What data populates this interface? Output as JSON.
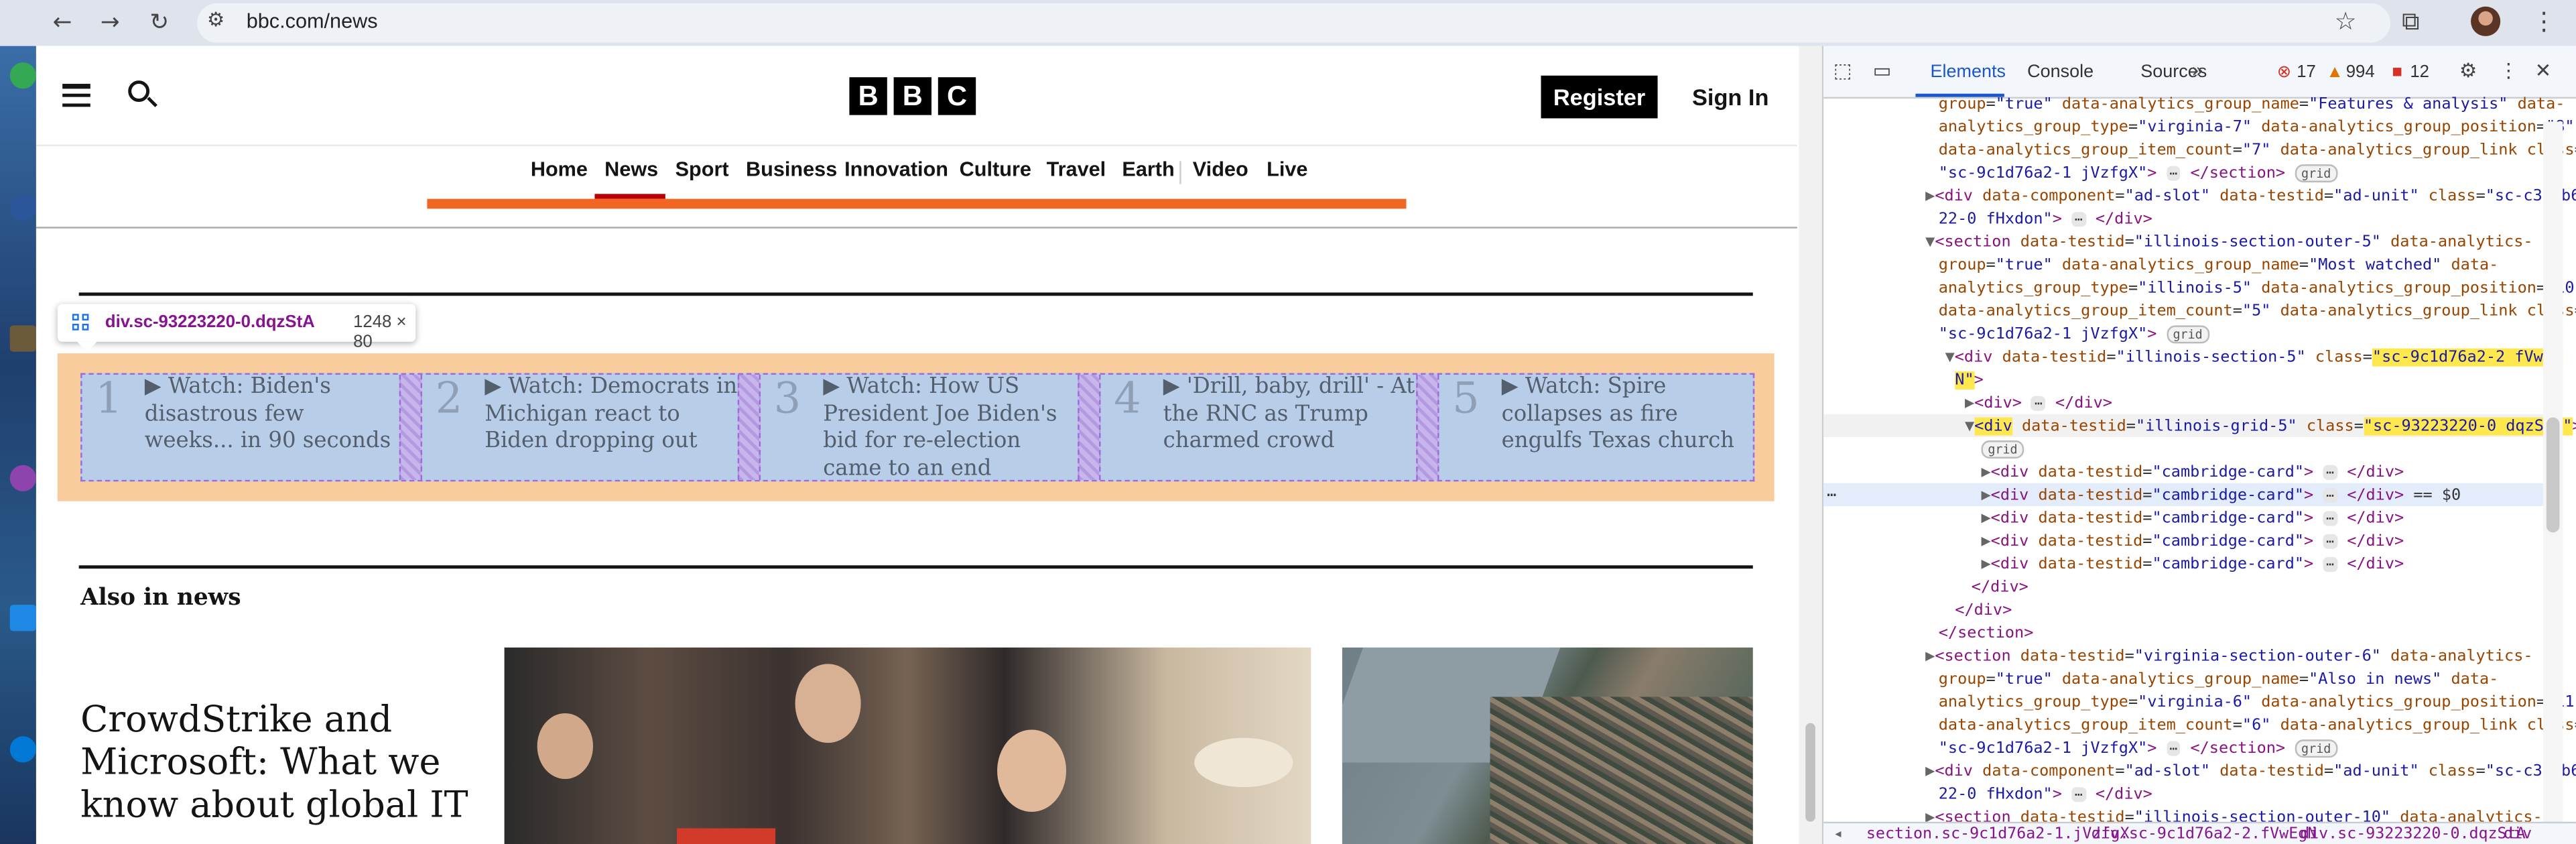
{
  "browser": {
    "url": "bbc.com/news"
  },
  "header": {
    "logo_letters": [
      "B",
      "B",
      "C"
    ],
    "register_label": "Register",
    "signin_label": "Sign In"
  },
  "nav": {
    "items": [
      "Home",
      "News",
      "Sport",
      "Business",
      "Innovation",
      "Culture",
      "Travel",
      "Earth",
      "Video",
      "Live"
    ],
    "active": "News"
  },
  "inspector_tooltip": {
    "selector": "div.sc-93223220-0.dqzStA",
    "size": "1248 × 80"
  },
  "most_watched": [
    {
      "rank": "1",
      "title": "Watch: Biden's disastrous few weeks... in 90 seconds"
    },
    {
      "rank": "2",
      "title": "Watch: Democrats in Michigan react to Biden dropping out"
    },
    {
      "rank": "3",
      "title": "Watch: How US President Joe Biden's bid for re-election came to an end"
    },
    {
      "rank": "4",
      "title": "'Drill, baby, drill' - At the RNC as Trump charmed crowd"
    },
    {
      "rank": "5",
      "title": "Watch: Spire collapses as fire engulfs Texas church"
    }
  ],
  "also_in_news": {
    "title": "Also in news",
    "headline": "CrowdStrike and Microsoft: What we know about global IT"
  },
  "devtools": {
    "tabs": [
      "Elements",
      "Console",
      "Sources"
    ],
    "active_tab": "Elements",
    "errors": "17",
    "warnings": "994",
    "issues": "12",
    "breadcrumbs": [
      "section.sc-9c1d76a2-1.jVzfgX",
      "div.sc-9c1d76a2-2.fVwEgN",
      "div.sc-93223220-0.dqzStA",
      "div"
    ]
  },
  "colors": {
    "accent_red": "#b80000",
    "promo_orange": "#f26522",
    "devtools_blue": "#1a57c8"
  }
}
